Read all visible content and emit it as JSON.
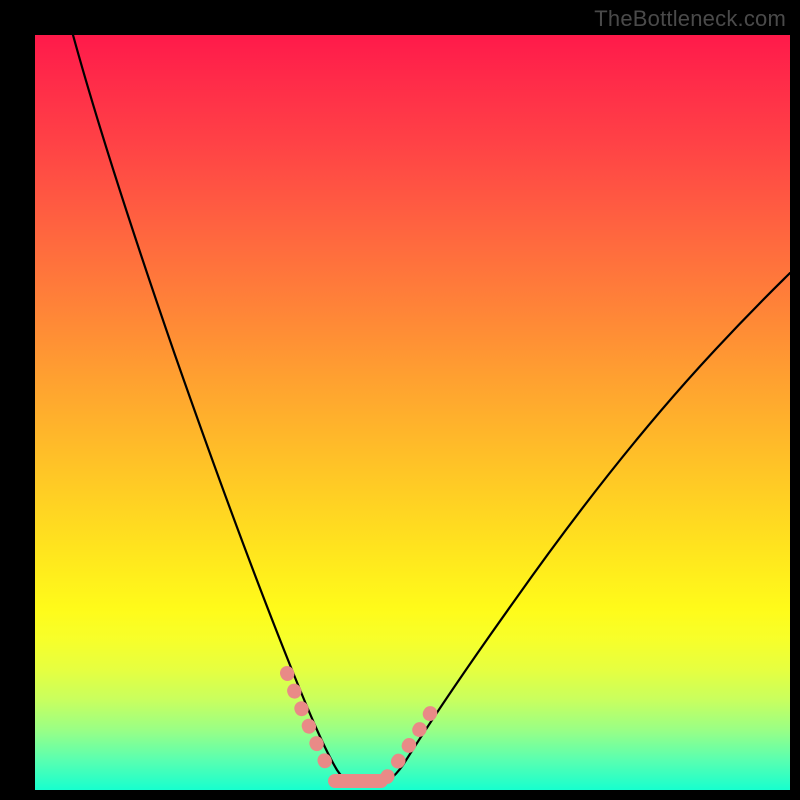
{
  "watermark": "TheBottleneck.com",
  "chart_data": {
    "type": "line",
    "title": "",
    "xlabel": "",
    "ylabel": "",
    "xlim": [
      0,
      100
    ],
    "ylim": [
      0,
      100
    ],
    "grid": false,
    "legend": false,
    "series": [
      {
        "name": "bottleneck-curve",
        "color": "#000000",
        "x": [
          5,
          10,
          15,
          20,
          25,
          30,
          35,
          38,
          40,
          42,
          44,
          46,
          50,
          55,
          60,
          65,
          70,
          75,
          80,
          85,
          90,
          95,
          100
        ],
        "y": [
          100,
          82,
          66,
          52,
          40,
          28,
          16,
          8,
          3,
          1,
          1,
          3,
          9,
          17,
          24,
          30,
          36,
          41,
          46,
          51,
          56,
          60,
          65
        ]
      }
    ],
    "highlighted_segments": [
      {
        "name": "left-wall-marker",
        "color": "#e98a87",
        "x_range": [
          33,
          39
        ],
        "y_range": [
          2,
          14
        ]
      },
      {
        "name": "floor-marker",
        "color": "#e98a87",
        "x_range": [
          39,
          46
        ],
        "y_range": [
          0.5,
          2
        ]
      },
      {
        "name": "right-wall-marker",
        "color": "#e98a87",
        "x_range": [
          46,
          52
        ],
        "y_range": [
          2,
          12
        ]
      }
    ],
    "background_gradient": {
      "type": "vertical",
      "stops": [
        {
          "pos": 0,
          "color": "#ff1a4a"
        },
        {
          "pos": 50,
          "color": "#ffb82a"
        },
        {
          "pos": 80,
          "color": "#f7ff2a"
        },
        {
          "pos": 100,
          "color": "#17ffce"
        }
      ]
    }
  }
}
